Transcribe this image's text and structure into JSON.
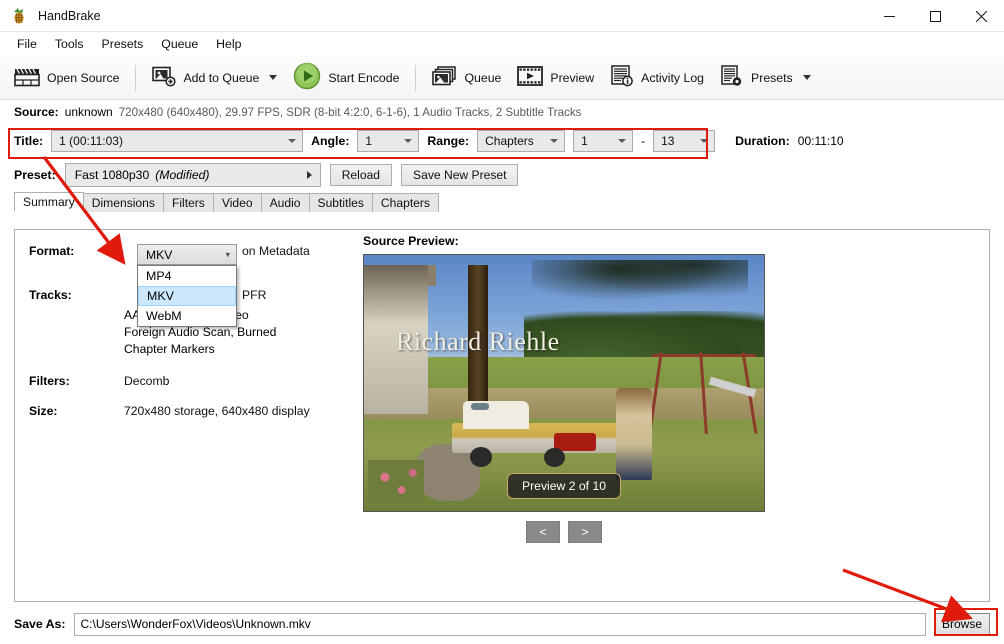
{
  "window": {
    "title": "HandBrake",
    "app_icon": "handbrake-pineapple-icon",
    "minimize": "─",
    "maximize": "□",
    "close": "✕"
  },
  "menubar": {
    "items": [
      "File",
      "Tools",
      "Presets",
      "Queue",
      "Help"
    ]
  },
  "toolbar": {
    "items": [
      {
        "label": "Open Source",
        "icon": "clapperboard-icon",
        "dropdown": false
      },
      {
        "label": "Add to Queue",
        "icon": "add-image-icon",
        "dropdown": true
      },
      {
        "label": "Start Encode",
        "icon": "green-play-icon",
        "dropdown": false
      },
      {
        "label": "Queue",
        "icon": "stacked-images-icon",
        "dropdown": false
      },
      {
        "label": "Preview",
        "icon": "film-play-icon",
        "dropdown": false
      },
      {
        "label": "Activity Log",
        "icon": "log-info-icon",
        "dropdown": false
      },
      {
        "label": "Presets",
        "icon": "document-gear-icon",
        "dropdown": true
      }
    ]
  },
  "source": {
    "label": "Source:",
    "name": "unknown",
    "details": "720x480 (640x480), 29.97 FPS, SDR (8-bit 4:2:0, 6-1-6), 1 Audio Tracks, 2 Subtitle Tracks"
  },
  "title_row": {
    "title_label": "Title:",
    "title_value": "1  (00:11:03)",
    "angle_label": "Angle:",
    "angle_value": "1",
    "range_label": "Range:",
    "range_value": "Chapters",
    "chapter_start": "1",
    "chapter_dash": "-",
    "chapter_end": "13",
    "duration_label": "Duration:",
    "duration_value": "00:11:10"
  },
  "preset_row": {
    "label": "Preset:",
    "value": "Fast 1080p30",
    "modified": "(Modified)",
    "reload_label": "Reload",
    "save_new_label": "Save New Preset"
  },
  "tabs": [
    {
      "label": "Summary",
      "active": true
    },
    {
      "label": "Dimensions",
      "active": false
    },
    {
      "label": "Filters",
      "active": false
    },
    {
      "label": "Video",
      "active": false
    },
    {
      "label": "Audio",
      "active": false
    },
    {
      "label": "Subtitles",
      "active": false
    },
    {
      "label": "Chapters",
      "active": false
    }
  ],
  "summary": {
    "format_label": "Format:",
    "format_value": "MKV",
    "format_options": [
      "MP4",
      "MKV",
      "WebM"
    ],
    "format_selected": "MKV",
    "metadata_text": "on Metadata",
    "tracks_label": "Tracks:",
    "tracks_first_suffix": "PFR",
    "tracks": [
      "AAC (avcodec), Stereo",
      "Foreign Audio Scan, Burned",
      "Chapter Markers"
    ],
    "filters_label": "Filters:",
    "filters_value": "Decomb",
    "size_label": "Size:",
    "size_value": "720x480 storage, 640x480 display"
  },
  "preview": {
    "label": "Source Preview:",
    "credit_text": "Richard Riehle",
    "badge": "Preview 2 of 10",
    "prev_btn": "<",
    "next_btn": ">"
  },
  "save_as": {
    "label": "Save As:",
    "path": "C:\\Users\\WonderFox\\Videos\\Unknown.mkv",
    "browse_label": "Browse"
  },
  "annotations": {
    "accent_color": "#e01b0c",
    "arrow_1": "title-to-format-arrow",
    "arrow_2": "to-browse-arrow",
    "box_1": "title-range-highlight-box",
    "box_2": "browse-highlight-box"
  }
}
